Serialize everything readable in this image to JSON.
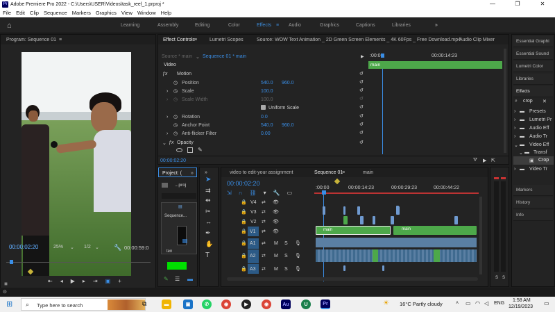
{
  "window": {
    "title": "Adobe Premiere Pro 2022 - C:\\Users\\USER\\Videos\\task_reel_1.prproj *",
    "logo": "Pr",
    "minimize": "—",
    "maximize": "❐",
    "close": "✕"
  },
  "menu": [
    "File",
    "Edit",
    "Clip",
    "Sequence",
    "Markers",
    "Graphics",
    "View",
    "Window",
    "Help"
  ],
  "workspaces": {
    "tabs": [
      "Learning",
      "Assembly",
      "Editing",
      "Color",
      "Effects",
      "Audio",
      "Graphics",
      "Captions",
      "Libraries"
    ],
    "active": "Effects",
    "more": "»"
  },
  "program": {
    "title": "Program: Sequence 01",
    "timecode": "00:00:02:20",
    "zoom": "25%",
    "quality": "1/2",
    "duration": "00:00:59:0"
  },
  "effect_controls": {
    "tabs": [
      "Effect Controls",
      "Lumetri Scopes",
      "Source: WOW Text Animation _ 2D Green Screen Elements _ 4K 60Fps _ Free Download.mp4",
      "Audio Clip Mixer"
    ],
    "source_label": "Source * main",
    "sequence_label": "Sequence 01 * main",
    "timecode_start": ":00:00",
    "timecode_mid": "00:00:14:23",
    "clip_name": "main",
    "section": "Video",
    "props": [
      {
        "name": "Motion",
        "value": "",
        "value2": ""
      },
      {
        "name": "Position",
        "value": "540.0",
        "value2": "960.0"
      },
      {
        "name": "Scale",
        "value": "100.0",
        "value2": ""
      },
      {
        "name": "Scale Width",
        "value": "100.0",
        "value2": ""
      },
      {
        "name": "Uniform Scale",
        "value": "",
        "value2": ""
      },
      {
        "name": "Rotation",
        "value": "0.0",
        "value2": ""
      },
      {
        "name": "Anchor Point",
        "value": "540.0",
        "value2": "960.0"
      },
      {
        "name": "Anti-flicker Filter",
        "value": "0.00",
        "value2": ""
      },
      {
        "name": "Opacity",
        "value": "",
        "value2": ""
      }
    ],
    "footer_timecode": "00:00:02:20"
  },
  "project": {
    "title": "Project: (",
    "file": "...proj",
    "seq": "Sequence...",
    "item": "ten"
  },
  "timeline": {
    "tabs": [
      "video to edit-your assignment",
      "Sequence 01",
      "main"
    ],
    "timecode": "00:00:02:20",
    "ruler": [
      ":00:00",
      "00:00:14:23",
      "00:00:29:23",
      "00:00:44:22"
    ],
    "tracks": [
      "V4",
      "V3",
      "V2",
      "V1",
      "A1",
      "A2",
      "A3"
    ],
    "clip_v1a": "main",
    "clip_v1b": "main"
  },
  "right_panel": {
    "items": [
      "Essential Graphi",
      "Essential Sound",
      "Lumetri Color",
      "Libraries",
      "Effects"
    ],
    "search": "crop",
    "tree": [
      "Presets",
      "Lumetri Pr",
      "Audio Eff",
      "Audio Tr",
      "Video Eff",
      "Transf",
      "Crop",
      "Video Tr"
    ],
    "lower": [
      "Markers",
      "History",
      "Info"
    ]
  },
  "taskbar": {
    "search_placeholder": "Type here to search",
    "weather": "16°C  Partly cloudy",
    "lang": "ENG",
    "time": "1:58 AM",
    "date": "12/19/2023"
  },
  "colors": {
    "accent": "#3a8ee6",
    "clip_green": "#4da84a",
    "audio_blue": "#5a7fa3"
  }
}
